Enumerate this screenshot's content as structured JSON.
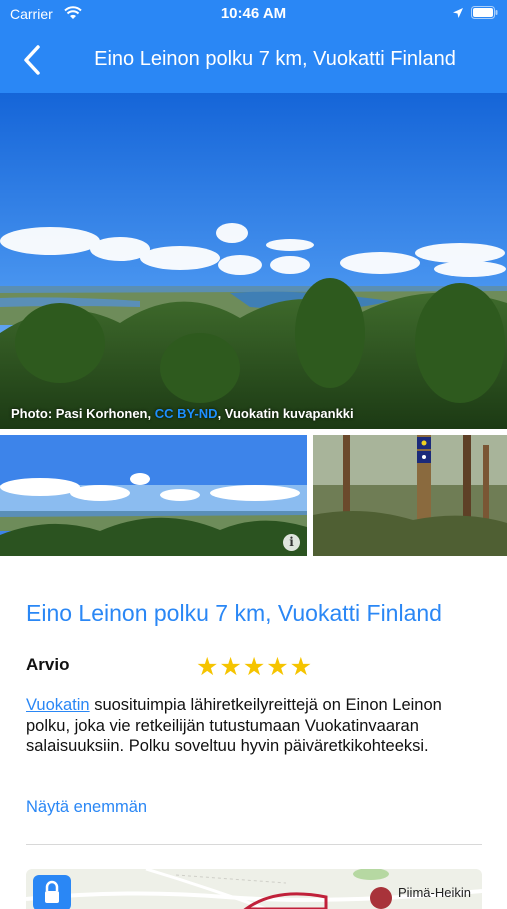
{
  "status": {
    "carrier": "Carrier",
    "time": "10:46 AM"
  },
  "nav": {
    "title": "Eino Leinon polku 7 km, Vuokatti Finland"
  },
  "hero": {
    "credit_prefix": "Photo: Pasi Korhonen, ",
    "credit_license": "CC BY-ND",
    "credit_suffix": ", Vuokatin kuvapankki"
  },
  "content": {
    "title": "Eino Leinon polku 7 km, Vuokatti Finland",
    "rating_label": "Arvio",
    "stars": "★★★★★",
    "rating_value": 5,
    "desc_link": "Vuokatin",
    "desc_text": " suosituimpia lähiretkeilyreittejä on Einon Leinon polku, joka vie retkeilijän tutustumaan Vuokatinvaaran salaisuuksiin. Polku soveltuu hyvin päiväretkikohteeksi.",
    "show_more": "Näytä enemmän"
  },
  "map": {
    "place_label": "Piimä-Heikin"
  },
  "colors": {
    "accent": "#2a87f5",
    "star": "#f5c400"
  }
}
